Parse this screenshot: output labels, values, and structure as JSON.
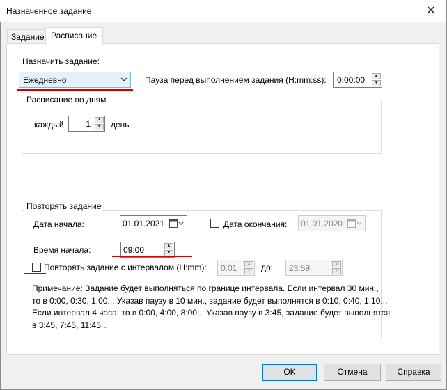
{
  "window": {
    "title": "Назначенное задание",
    "close_glyph": "✕"
  },
  "tabs": [
    {
      "label": "Задание"
    },
    {
      "label": "Расписание"
    }
  ],
  "schedule": {
    "assign_label": "Назначить задание:",
    "assign_value": "Ежедневно",
    "pause_label": "Пауза перед выполнением задания (H:mm:ss):",
    "pause_value": "0:00:00"
  },
  "daily": {
    "group_label": "Расписание по дням",
    "every_label": "каждый",
    "every_value": "1",
    "unit_label": "день"
  },
  "repeat": {
    "group_label": "Повторять задание",
    "start_date_label": "Дата начала:",
    "start_date_value": "01.01.2021",
    "end_date_label": "Дата окончания:",
    "end_date_value": "01.01.2020",
    "start_time_label": "Время начала:",
    "start_time_value": "09:00",
    "interval_label": "Повторять задание с интервалом (H:mm):",
    "interval_value": "0:01",
    "to_label": "до:",
    "to_value": "23:59",
    "note_lines": [
      "Примечание: Задание будет выполняться по границе интервала. Если интервал 30 мин.,",
      "то в 0:00, 0:30, 1:00... Указав паузу в 10 мин., задание будет выполнятся в 0:10, 0:40, 1:10...",
      "Если интервал 4 часа, то в 0:00, 4:00, 8:00... Указав паузу в 3:45, задание будет выполнятся",
      "в 3:45, 7:45, 11:45..."
    ]
  },
  "buttons": {
    "ok": "OK",
    "cancel": "Отмена",
    "help": "Справка"
  },
  "colors": {
    "accent_underline": "#d20000",
    "default_button_border": "#0078d7"
  },
  "icons": [
    "close-icon",
    "chevron-down-icon",
    "calendar-icon",
    "spin-up-icon",
    "spin-down-icon"
  ]
}
